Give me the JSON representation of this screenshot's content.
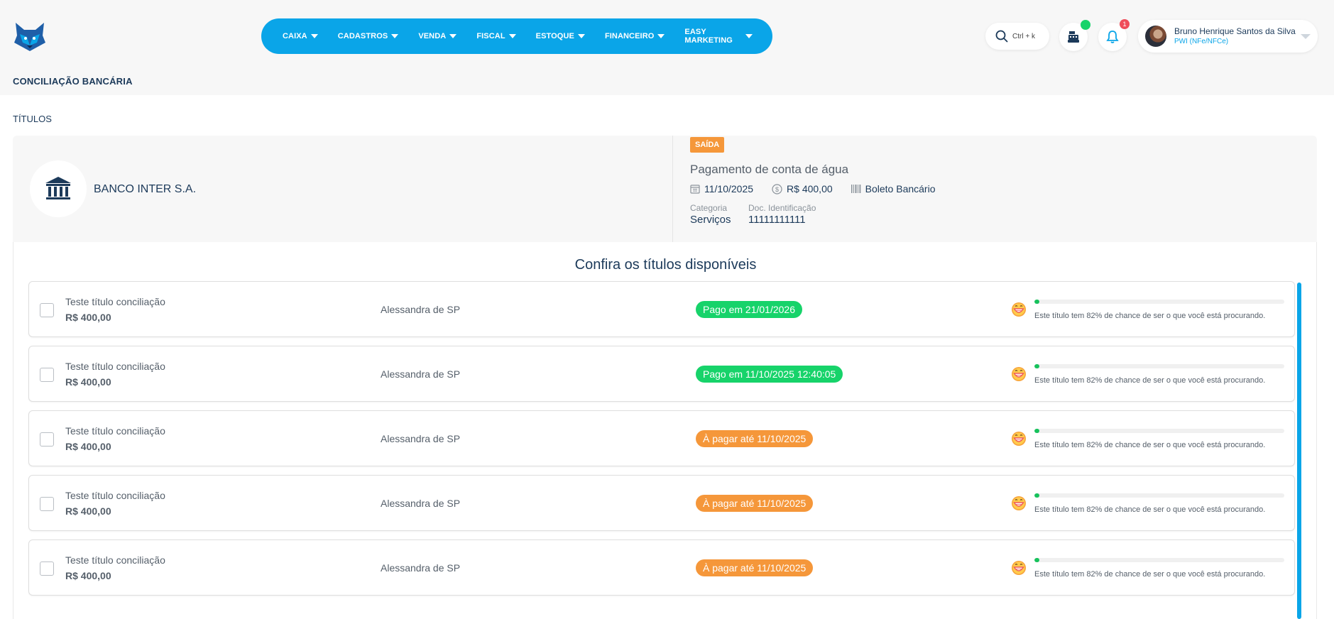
{
  "nav": {
    "items": [
      "CAIXA",
      "CADASTROS",
      "VENDA",
      "FISCAL",
      "ESTOQUE",
      "FINANCEIRO",
      "EASY MARKETING"
    ]
  },
  "search": {
    "shortcut": "Ctrl + k"
  },
  "notifications": {
    "count": "1"
  },
  "user": {
    "name": "Bruno Henrique Santos da Silva",
    "role": "PWI (NFe/NFCe)"
  },
  "page": {
    "title": "CONCILIAÇÃO BANCÁRIA",
    "section": "TÍTULOS"
  },
  "transaction": {
    "bank": "BANCO INTER S.A.",
    "type_badge": "SAÍDA",
    "description": "Pagamento de conta de água",
    "date": "11/10/2025",
    "amount": "R$ 400,00",
    "method": "Boleto Bancário",
    "category_label": "Categoria",
    "category": "Serviços",
    "doc_label": "Doc. Identificação",
    "doc": "11111111111"
  },
  "panel": {
    "title": "Confira os títulos disponíveis"
  },
  "colors": {
    "brand": "#0aa5e8",
    "paid": "#17d36a",
    "pending": "#f5973a",
    "navy": "#1c3a5a"
  },
  "titles": [
    {
      "title": "Teste título conciliação",
      "amount": "R$ 400,00",
      "person": "Alessandra de SP",
      "status": "Pago em 21/01/2026",
      "status_kind": "paid",
      "chance_pct": 2,
      "chance_text": "Este título tem 82% de chance de ser o que você está procurando."
    },
    {
      "title": "Teste título conciliação",
      "amount": "R$ 400,00",
      "person": "Alessandra de SP",
      "status": "Pago em 11/10/2025 12:40:05",
      "status_kind": "paid",
      "chance_pct": 2,
      "chance_text": "Este título tem 82% de chance de ser o que você está procurando."
    },
    {
      "title": "Teste título conciliação",
      "amount": "R$ 400,00",
      "person": "Alessandra de SP",
      "status": "À pagar até 11/10/2025",
      "status_kind": "pending",
      "chance_pct": 2,
      "chance_text": "Este título tem 82% de chance de ser o que você está procurando."
    },
    {
      "title": "Teste título conciliação",
      "amount": "R$ 400,00",
      "person": "Alessandra de SP",
      "status": "À pagar até 11/10/2025",
      "status_kind": "pending",
      "chance_pct": 2,
      "chance_text": "Este título tem 82% de chance de ser o que você está procurando."
    },
    {
      "title": "Teste título conciliação",
      "amount": "R$ 400,00",
      "person": "Alessandra de SP",
      "status": "À pagar até 11/10/2025",
      "status_kind": "pending",
      "chance_pct": 2,
      "chance_text": "Este título tem 82% de chance de ser o que você está procurando."
    }
  ]
}
